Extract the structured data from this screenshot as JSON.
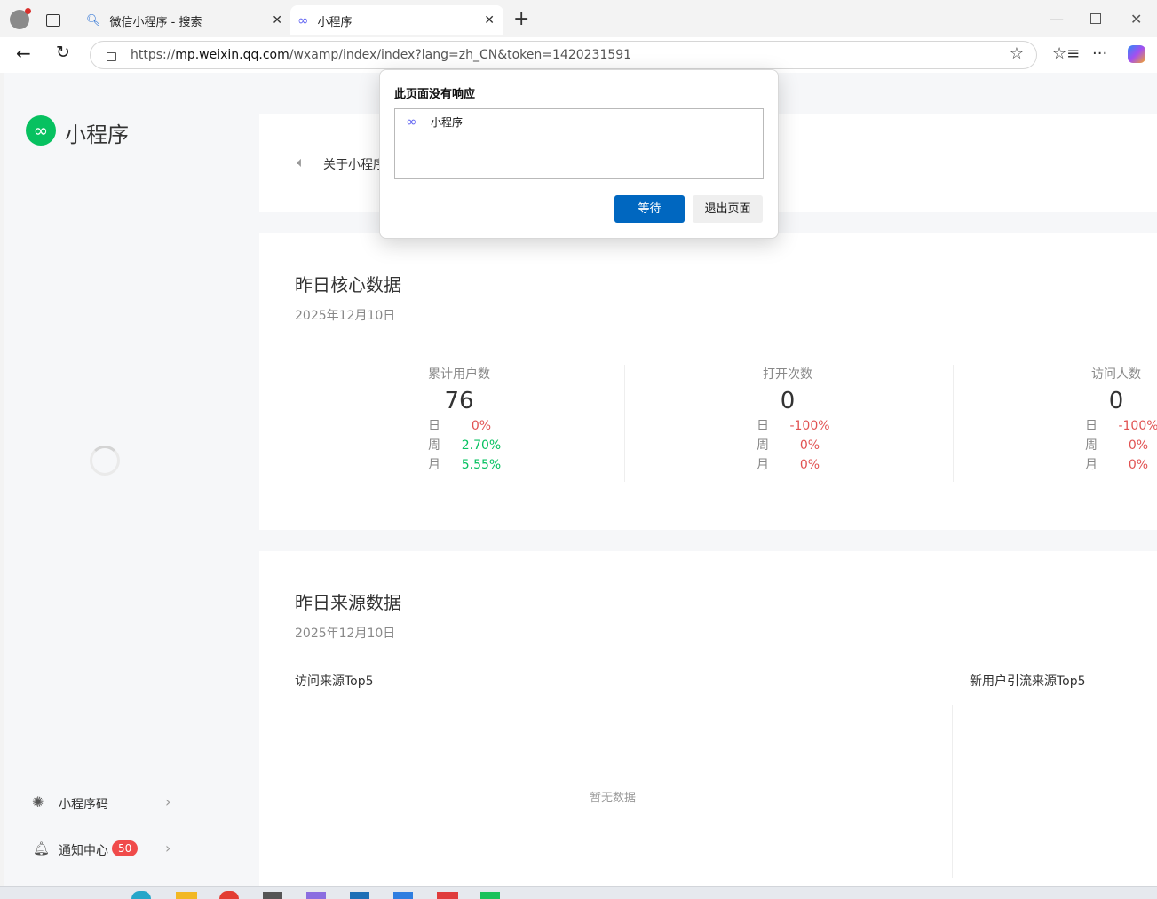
{
  "browser": {
    "tabs": [
      {
        "title": "微信小程序 - 搜索"
      },
      {
        "title": "小程序"
      }
    ],
    "url": {
      "prefix": "https://",
      "host": "mp.weixin.qq.com",
      "path": "/wxamp/index/index?lang=zh_CN&token=1420231591"
    }
  },
  "sidebar": {
    "brand": "小程序",
    "items": [
      {
        "label": "小程序码"
      },
      {
        "label": "通知中心",
        "badge": "50"
      }
    ]
  },
  "notice": {
    "text": "关于小程序"
  },
  "core": {
    "title": "昨日核心数据",
    "date": "2025年12月10日",
    "metrics": [
      {
        "label": "累计用户数",
        "value": "76",
        "day_k": "日",
        "day": "0%",
        "week_k": "周",
        "week": "2.70%",
        "month_k": "月",
        "month": "5.55%"
      },
      {
        "label": "打开次数",
        "value": "0",
        "day_k": "日",
        "day": "-100%",
        "week_k": "周",
        "week": "0%",
        "month_k": "月",
        "month": "0%"
      },
      {
        "label": "访问人数",
        "value": "0",
        "day_k": "日",
        "day": "-100%",
        "week_k": "周",
        "week": "0%",
        "month_k": "月",
        "month": "0%"
      }
    ]
  },
  "source": {
    "title": "昨日来源数据",
    "date": "2025年12月10日",
    "left_title": "访问来源Top5",
    "right_title": "新用户引流来源Top5",
    "empty": "暂无数据"
  },
  "dialog": {
    "title": "此页面没有响应",
    "item": "小程序",
    "wait": "等待",
    "exit": "退出页面"
  },
  "colors": {
    "accent": "#07c160",
    "negative": "#e15252",
    "button": "#0067c0",
    "badge": "#f04b4b"
  }
}
